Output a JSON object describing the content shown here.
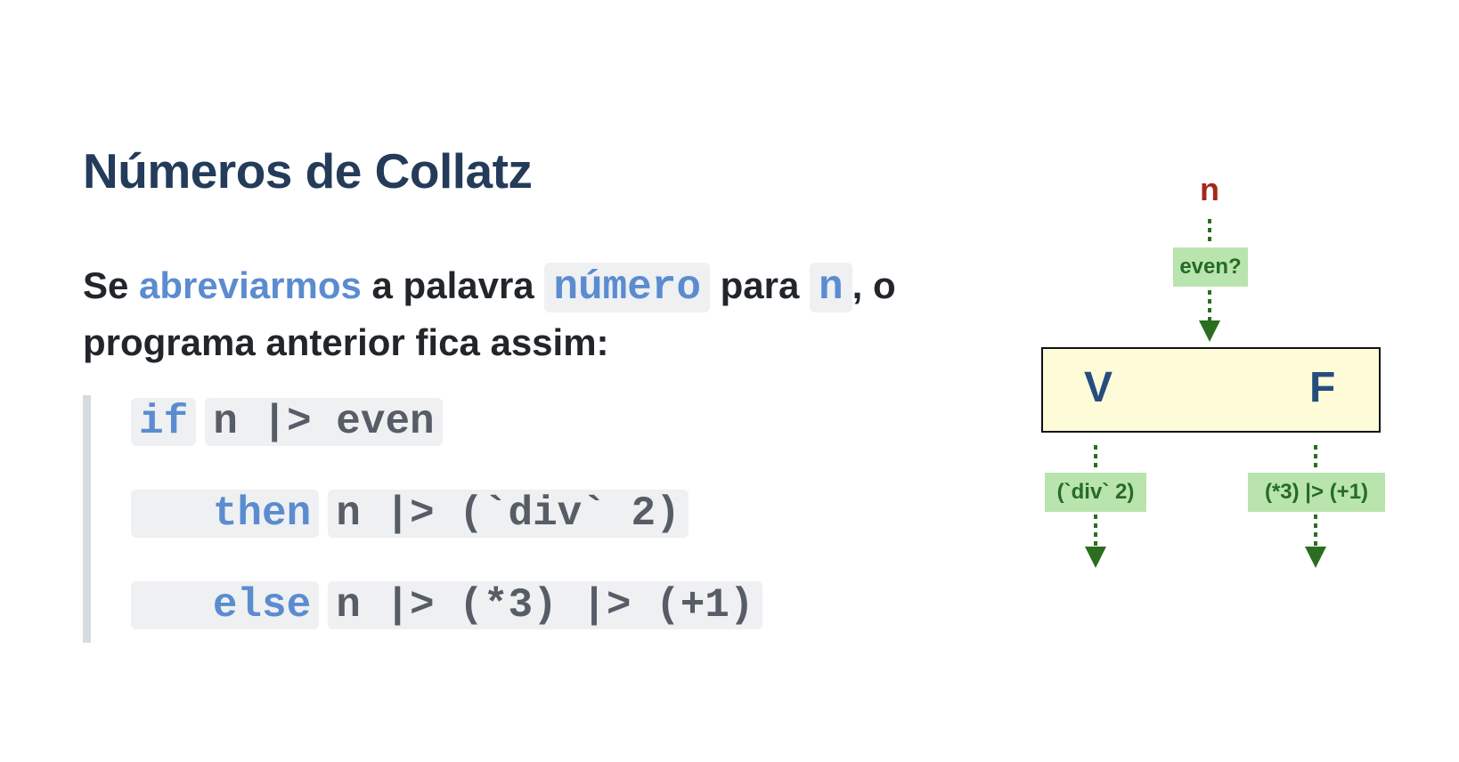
{
  "title": "Números de Collatz",
  "paragraph": {
    "t1": "Se",
    "link": "abreviarmos",
    "t2": "a palavra",
    "code1": "número",
    "t3": "para",
    "code2": "n",
    "t4": ", o programa anterior fica assim:"
  },
  "code": {
    "l1_kw": "if",
    "l1_expr": "n |> even",
    "l2_kw": "   then",
    "l2_expr": "n |> (`div` 2)",
    "l3_kw": "   else",
    "l3_expr": "n |> (*3) |> (+1)"
  },
  "diagram": {
    "input": "n",
    "test": "even?",
    "true_label": "V",
    "false_label": "F",
    "true_op": "(`div` 2)",
    "false_op": "(*3) |> (+1)",
    "colors": {
      "arrow": "#2c6e1f",
      "tag_bg": "#b9e4ad",
      "box_bg": "#fefbd9",
      "input": "#a3291c"
    }
  }
}
